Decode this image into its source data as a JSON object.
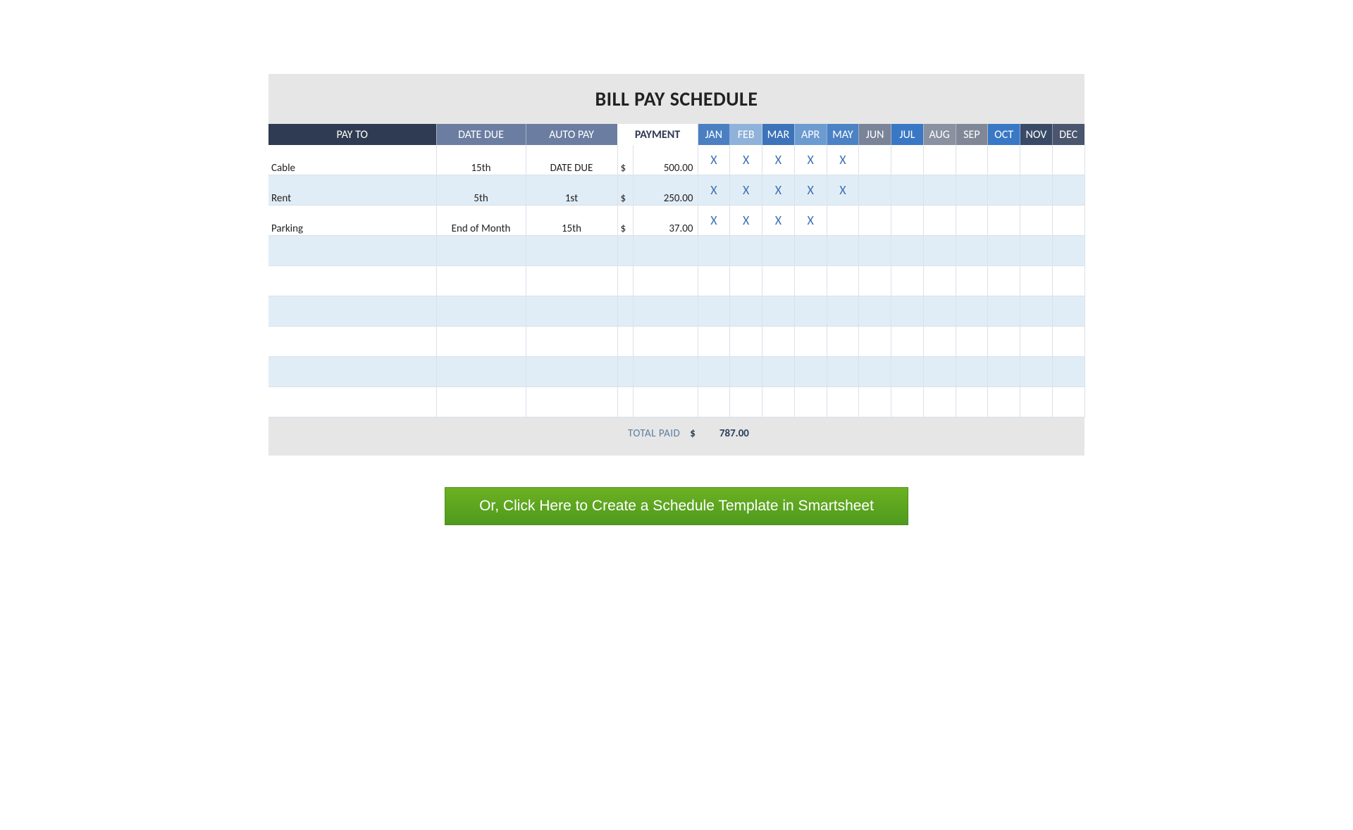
{
  "title": "BILL PAY SCHEDULE",
  "headers": {
    "pay_to": "PAY TO",
    "date_due": "DATE DUE",
    "auto_pay": "AUTO PAY",
    "payment": "PAYMENT"
  },
  "months": [
    "JAN",
    "FEB",
    "MAR",
    "APR",
    "MAY",
    "JUN",
    "JUL",
    "AUG",
    "SEP",
    "OCT",
    "NOV",
    "DEC"
  ],
  "mark": "X",
  "currency": "$",
  "rows": [
    {
      "pay_to": "Cable",
      "date_due": "15th",
      "auto_pay": "DATE DUE",
      "amount": "500.00",
      "months": [
        true,
        true,
        true,
        true,
        true,
        false,
        false,
        false,
        false,
        false,
        false,
        false
      ]
    },
    {
      "pay_to": "Rent",
      "date_due": "5th",
      "auto_pay": "1st",
      "amount": "250.00",
      "months": [
        true,
        true,
        true,
        true,
        true,
        false,
        false,
        false,
        false,
        false,
        false,
        false
      ]
    },
    {
      "pay_to": "Parking",
      "date_due": "End of Month",
      "auto_pay": "15th",
      "amount": "37.00",
      "months": [
        true,
        true,
        true,
        true,
        false,
        false,
        false,
        false,
        false,
        false,
        false,
        false
      ]
    },
    {
      "pay_to": "",
      "date_due": "",
      "auto_pay": "",
      "amount": "",
      "months": [
        false,
        false,
        false,
        false,
        false,
        false,
        false,
        false,
        false,
        false,
        false,
        false
      ]
    },
    {
      "pay_to": "",
      "date_due": "",
      "auto_pay": "",
      "amount": "",
      "months": [
        false,
        false,
        false,
        false,
        false,
        false,
        false,
        false,
        false,
        false,
        false,
        false
      ]
    },
    {
      "pay_to": "",
      "date_due": "",
      "auto_pay": "",
      "amount": "",
      "months": [
        false,
        false,
        false,
        false,
        false,
        false,
        false,
        false,
        false,
        false,
        false,
        false
      ]
    },
    {
      "pay_to": "",
      "date_due": "",
      "auto_pay": "",
      "amount": "",
      "months": [
        false,
        false,
        false,
        false,
        false,
        false,
        false,
        false,
        false,
        false,
        false,
        false
      ]
    },
    {
      "pay_to": "",
      "date_due": "",
      "auto_pay": "",
      "amount": "",
      "months": [
        false,
        false,
        false,
        false,
        false,
        false,
        false,
        false,
        false,
        false,
        false,
        false
      ]
    },
    {
      "pay_to": "",
      "date_due": "",
      "auto_pay": "",
      "amount": "",
      "months": [
        false,
        false,
        false,
        false,
        false,
        false,
        false,
        false,
        false,
        false,
        false,
        false
      ]
    }
  ],
  "total": {
    "label": "TOTAL PAID",
    "currency": "$",
    "value": "787.00"
  },
  "cta": "Or, Click Here to Create a Schedule Template in Smartsheet",
  "month_header_classes": [
    "th-blue1",
    "th-blue2",
    "th-blue3",
    "th-blue4",
    "th-blue5",
    "th-gry",
    "th-blue6",
    "th-gry2",
    "th-gry3",
    "th-blue7",
    "th-dark2",
    "th-dark3"
  ]
}
